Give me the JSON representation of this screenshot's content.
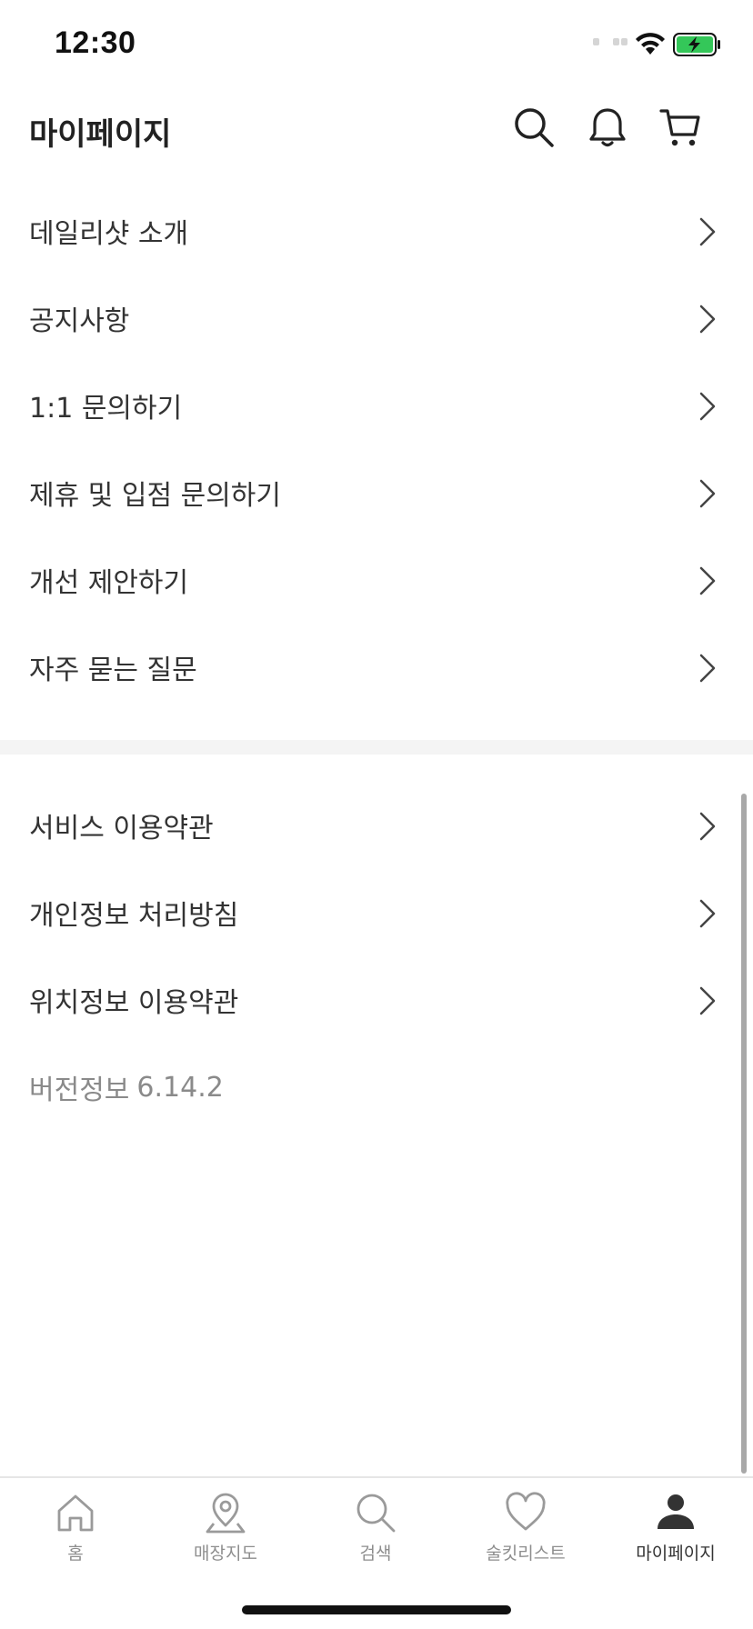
{
  "status_bar": {
    "time": "12:30"
  },
  "header": {
    "title": "마이페이지",
    "icons": [
      "search-icon",
      "bell-icon",
      "cart-icon"
    ]
  },
  "menu_group_1": [
    {
      "label": "데일리샷 소개"
    },
    {
      "label": "공지사항"
    },
    {
      "label": "1:1 문의하기"
    },
    {
      "label": "제휴 및 입점 문의하기"
    },
    {
      "label": "개선 제안하기"
    },
    {
      "label": "자주 묻는 질문"
    }
  ],
  "menu_group_2": [
    {
      "label": "서비스 이용약관"
    },
    {
      "label": "개인정보 처리방침"
    },
    {
      "label": "위치정보 이용약관"
    }
  ],
  "version": {
    "label": "버전정보",
    "value": "6.14.2"
  },
  "tab_bar": {
    "tabs": [
      {
        "label": "홈",
        "icon": "home-icon"
      },
      {
        "label": "매장지도",
        "icon": "map-pin-icon"
      },
      {
        "label": "검색",
        "icon": "search-icon"
      },
      {
        "label": "술킷리스트",
        "icon": "heart-icon"
      },
      {
        "label": "마이페이지",
        "icon": "person-icon"
      }
    ],
    "active": "마이페이지"
  },
  "colors": {
    "text_primary": "#333333",
    "text_muted": "#8a8a8a",
    "battery_green": "#34c759",
    "divider": "#f4f4f4"
  }
}
